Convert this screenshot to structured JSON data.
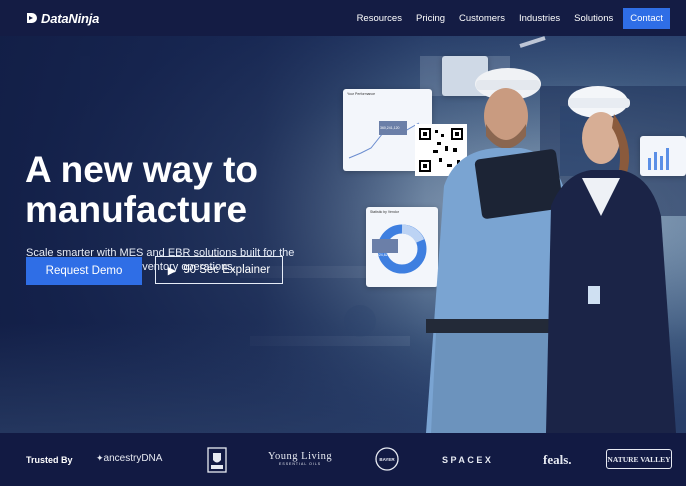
{
  "brand": {
    "name": "DataNinja"
  },
  "nav": {
    "items": [
      "Resources",
      "Pricing",
      "Customers",
      "Industries",
      "Solutions"
    ],
    "contact": "Contact"
  },
  "hero": {
    "headline_line1": "A new way to",
    "headline_line2": "manufacture",
    "subtext": "Scale smarter with MES and EBR solutions built for the business of regulated inventory operations.",
    "primary_cta": "Request Demo",
    "secondary_cta": "90 Sec Explainer",
    "overlay_card_title": "Statistic by Vendor",
    "overlay_card_value": "1,024,621",
    "overlay_chart_title": "Your Performance",
    "overlay_chart_value": "360,241,120"
  },
  "trusted": {
    "label": "Trusted By",
    "logos": [
      "ancestryDNA",
      "Crest",
      "Young Living",
      "BAYER",
      "SPACEX",
      "feals.",
      "NATURE VALLEY"
    ],
    "young_living_sub": "ESSENTIAL OILS"
  },
  "colors": {
    "header": "#141c44",
    "accent": "#2f6ee6",
    "trust_bar": "#121a43"
  }
}
